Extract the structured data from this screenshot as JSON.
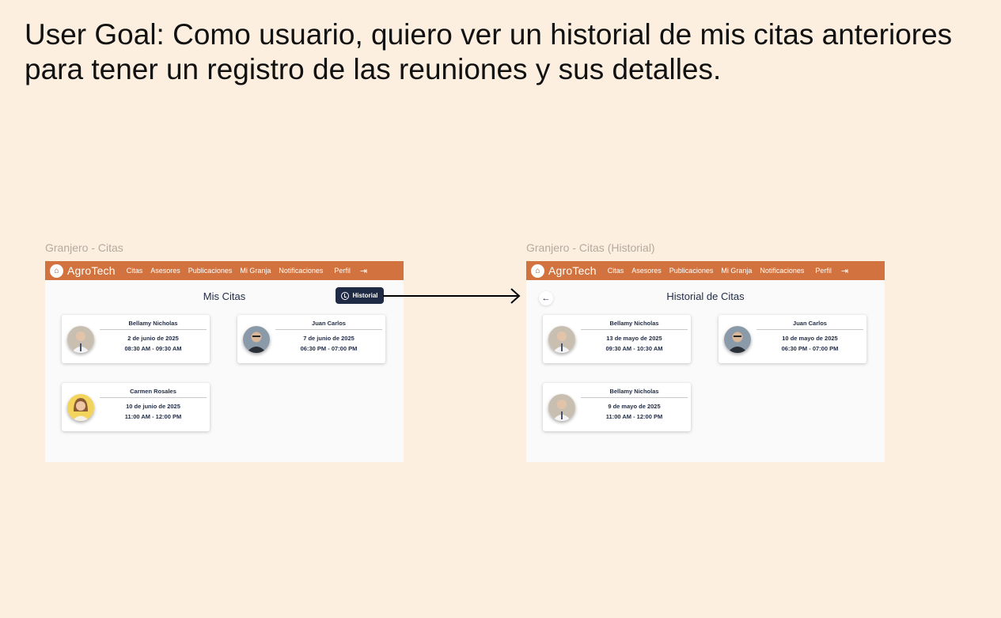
{
  "goal": "User Goal: Como usuario, quiero ver un historial de mis citas anteriores para tener un registro de las reuniones y sus detalles.",
  "nav": {
    "brand": "AgroTech",
    "items": [
      "Citas",
      "Asesores",
      "Publicaciones",
      "Mi Granja",
      "Notificaciones",
      "Perfil"
    ]
  },
  "screen1": {
    "label": "Granjero - Citas",
    "title": "Mis Citas",
    "history_button": "Historial",
    "cards": [
      {
        "name": "Bellamy Nicholas",
        "date": "2 de junio de 2025",
        "time": "08:30 AM - 09:30 AM"
      },
      {
        "name": "Juan Carlos",
        "date": "7 de junio de 2025",
        "time": "06:30 PM - 07:00 PM"
      },
      {
        "name": "Carmen Rosales",
        "date": "10 de junio de 2025",
        "time": "11:00 AM - 12:00 PM"
      }
    ]
  },
  "screen2": {
    "label": "Granjero - Citas (Historial)",
    "title": "Historial de Citas",
    "cards": [
      {
        "name": "Bellamy Nicholas",
        "date": "13 de mayo de 2025",
        "time": "09:30 AM - 10:30 AM"
      },
      {
        "name": "Juan Carlos",
        "date": "10 de mayo de 2025",
        "time": "06:30 PM - 07:00 PM"
      },
      {
        "name": "Bellamy Nicholas",
        "date": "9 de mayo de 2025",
        "time": "11:00 AM - 12:00 PM"
      }
    ]
  },
  "colors": {
    "nav": "#d2733f",
    "background": "#fcefe0",
    "primary": "#1f2a44"
  }
}
